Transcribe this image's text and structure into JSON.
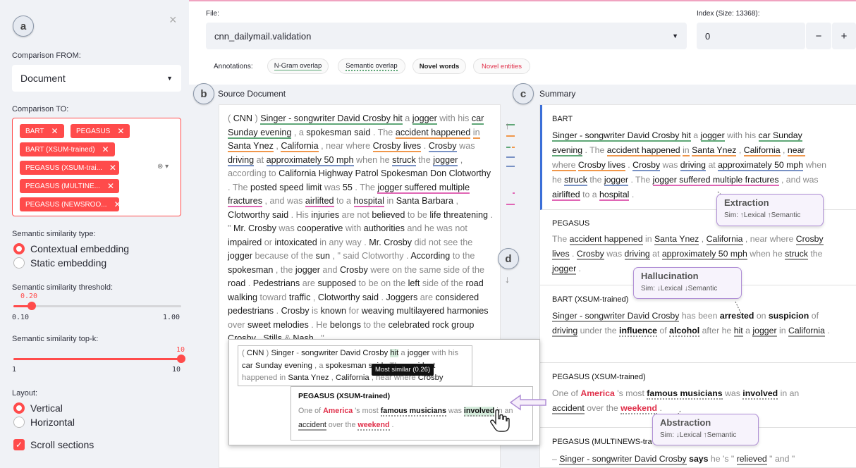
{
  "sidebar": {
    "circle_label": "a",
    "close": "×",
    "from_label": "Comparison FROM:",
    "from_value": "Document",
    "to_label": "Comparison TO:",
    "tags": [
      "BART",
      "PEGASUS",
      "BART (XSUM-trained)",
      "PEGASUS (XSUM-trai...",
      "PEGASUS (MULTINE...",
      "PEGASUS (NEWSROO..."
    ],
    "sim_type_label": "Semantic similarity type:",
    "sim_types": [
      "Contextual embedding",
      "Static embedding"
    ],
    "threshold_label": "Semantic similarity threshold:",
    "threshold_value": "0.20",
    "threshold_min": "0.10",
    "threshold_max": "1.00",
    "threshold_level": 0.11,
    "topk_label": "Semantic similarity top-k:",
    "topk_value": "10",
    "topk_min": "1",
    "topk_max": "10",
    "layout_label": "Layout:",
    "layouts": [
      "Vertical",
      "Horizontal"
    ],
    "scroll_label": "Scroll sections"
  },
  "top": {
    "file_label": "File:",
    "file_value": "cnn_dailymail.validation",
    "index_label": "Index (Size: 13368):",
    "index_value": "0",
    "minus": "−",
    "plus": "+",
    "annotations_label": "Annotations:",
    "chips": [
      "N-Gram overlap",
      "Semantic overlap",
      "Novel words",
      "Novel entities"
    ]
  },
  "source": {
    "circle_label": "b",
    "title": "Source Document"
  },
  "summary": {
    "circle_label": "c",
    "title": "Summary",
    "d_label": "d",
    "models": [
      "BART",
      "PEGASUS",
      "BART (XSUM-trained)",
      "PEGASUS (XSUM-trained)",
      "PEGASUS (MULTINEWS-tra"
    ]
  },
  "callouts": {
    "extraction": {
      "title": "Extraction",
      "sub": "Sim: ↑Lexical ↑Semantic"
    },
    "hallucination": {
      "title": "Hallucination",
      "sub": "Sim: ↓Lexical ↓Semantic"
    },
    "abstraction": {
      "title": "Abstraction",
      "sub": "Sim: ↓Lexical ↑Semantic"
    }
  },
  "popup": {
    "tooltip": "Most similar (0.26)",
    "model": "PEGASUS (XSUM-trained)"
  },
  "colors": {
    "accent": "#ff4b4b",
    "ngram": "#5fa777",
    "novel_entity": "#e0304a",
    "selected": "#3b6fd8"
  }
}
